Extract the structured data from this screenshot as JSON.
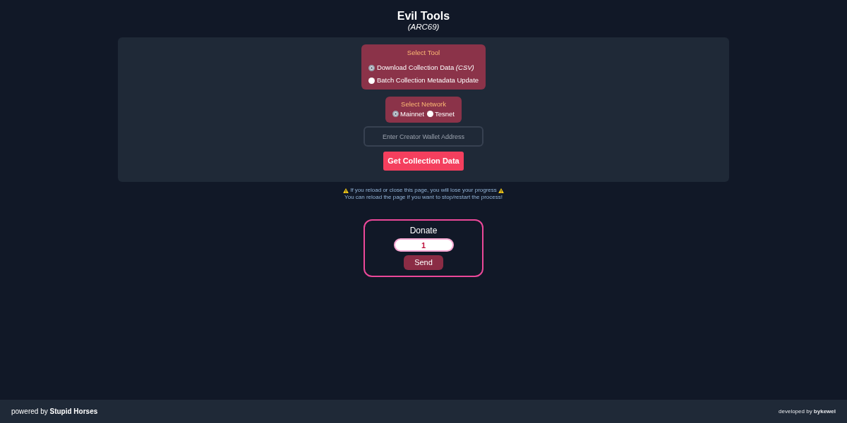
{
  "header": {
    "title": "Evil Tools",
    "subtitle": "(ARC69)"
  },
  "tool_select": {
    "label": "Select Tool",
    "options": [
      {
        "label": "Download Collection Data *(CSV)*",
        "selected": true
      },
      {
        "label": "Batch Collection Metadata Update",
        "selected": false
      }
    ]
  },
  "network_select": {
    "label": "Select Network",
    "options": [
      {
        "label": "Mainnet",
        "selected": true
      },
      {
        "label": "Tesnet",
        "selected": false
      }
    ]
  },
  "wallet_field": {
    "placeholder": "Enter Creator Wallet Address"
  },
  "primary_button": "Get Collection Data",
  "notices": [
    {
      "kind": "warning",
      "text": "If you reload or close this page, you will lose your progress"
    },
    {
      "kind": "plain",
      "text": "You can reload the page if you want to stop/restart the process!"
    }
  ],
  "donate": {
    "title": "Donate",
    "amount": "1",
    "button": "Send"
  },
  "footer": {
    "credit": "powered by **Stupid Horses**",
    "developer": "developed by **bykewel**"
  }
}
